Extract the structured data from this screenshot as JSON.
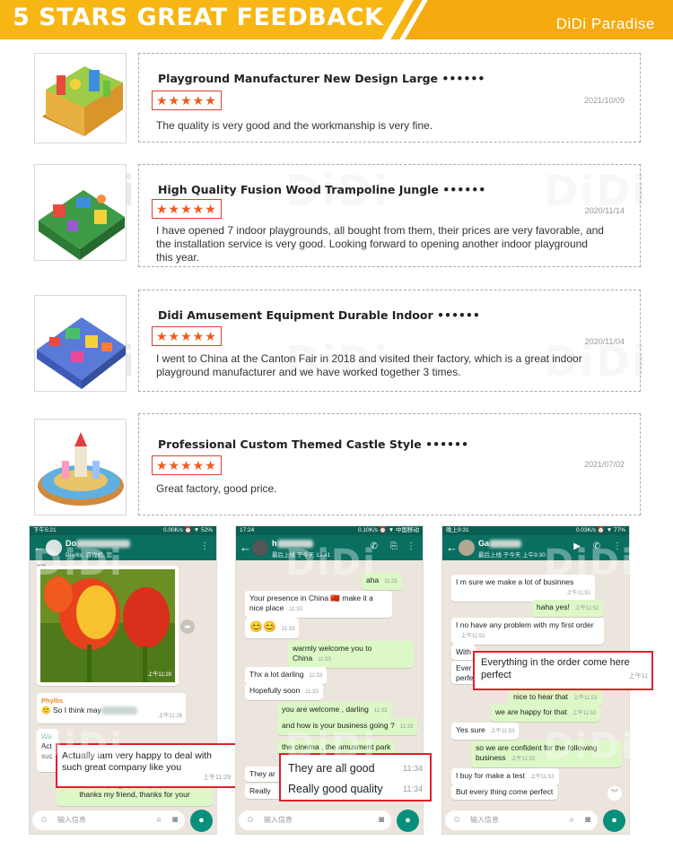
{
  "banner": {
    "title": "5 STARS GREAT FEEDBACK",
    "brand": "DiDi Paradise"
  },
  "watermark": "DiDi",
  "reviews": [
    {
      "title": "Playground Manufacturer New Design Large ••••••",
      "stars": "★★★★★",
      "date": "2021/10/09",
      "text": "The quality is very good and the workmanship is very fine."
    },
    {
      "title": "High Quality Fusion Wood Trampoline Jungle ••••••",
      "stars": "★★★★★",
      "date": "2020/11/14",
      "text": "I have opened 7 indoor playgrounds, all bought from them, their prices are very favorable, and the installation service is very good. Looking forward to opening another indoor playground this year."
    },
    {
      "title": "Didi Amusement Equipment Durable Indoor ••••••",
      "stars": "★★★★★",
      "date": "2020/11/04",
      "text": "I went to China at the Canton Fair in 2018 and visited their factory, which is a great indoor playground manufacturer and we have worked together 3 times."
    },
    {
      "title": "Professional Custom Themed Castle Style ••••••",
      "stars": "★★★★★",
      "date": "2021/07/02",
      "text": "Great factory, good price."
    }
  ],
  "chats": [
    {
      "status_left": "下午5:21",
      "status_right": "0.00K/s ⏰ ▼ 52%",
      "name": "Do",
      "subtitle": "Phyllis, 游戏机, 您",
      "input": "输入信息",
      "photo_time": "上午11:28",
      "sender": "Phyllis",
      "msg1": "🙂 So I think may",
      "msg1_time": "上午11:28",
      "hl": "Actually iam very happy to deal with such great company like you",
      "hl_time": "上午11:29",
      "msg2": "thanks my friend, thanks for your",
      "frag1": "Wa",
      "frag2": "Act",
      "frag3": "suc"
    },
    {
      "status_left": "17:24",
      "status_right": "0.10K/s ⏰ ▼ 中国移动",
      "name": "h",
      "subtitle": "最后上线 于今天 13:41",
      "input": "输入信息",
      "m1": "aha",
      "m1t": "11:33",
      "m2": "Your presence in China 🇨🇳 make it a nice place",
      "m2t": "11:33",
      "m3": "😊😊",
      "m3t": "11:33",
      "m4": "warmly welcome you  to China",
      "m4t": "11:33",
      "m5": "Thx a lot darling",
      "m5t": "11:33",
      "m6": "Hopefully soon",
      "m6t": "11:33",
      "m7": "you are welcome , darling",
      "m7t": "11:33",
      "m8": "and how is your business going ?",
      "m8t": "11:33",
      "m9": "the cinema , the amusment park",
      "hl1": "They are all good",
      "hl1t": "11:34",
      "hl2": "Really good quality",
      "hl2t": "11:34",
      "frag1": "They ar",
      "frag2": "Really"
    },
    {
      "status_left": "晚上9:31",
      "status_right": "0.03K/s ⏰ ▼ 77%",
      "name": "Ga",
      "subtitle": "最后上线 于今天 上午9:30",
      "input": "输入信息",
      "m1": "I m sure we make a lot of businnes",
      "m1t": "上午11:51",
      "m2": "haha yes!",
      "m2t": "上午11:52",
      "m3": "I no have any problem with my first order",
      "m3t": "上午11:52",
      "m4": "With",
      "hl": "Everything in the order come here perfect",
      "hlt": "上午11",
      "m5": "nice to hear that",
      "m5t": "上午11:53",
      "m6": "we are happy for that",
      "m6t": "上午11:53",
      "m7": "Yes sure",
      "m7t": "上午11:53",
      "m8": "so we are confident for the following business",
      "m8t": "上午11:53",
      "m9": "I buy for make a test",
      "m9t": "上午11:53",
      "m10": "But every thing come perfect",
      "frag1": "Ever",
      "frag2": "perfe"
    }
  ]
}
